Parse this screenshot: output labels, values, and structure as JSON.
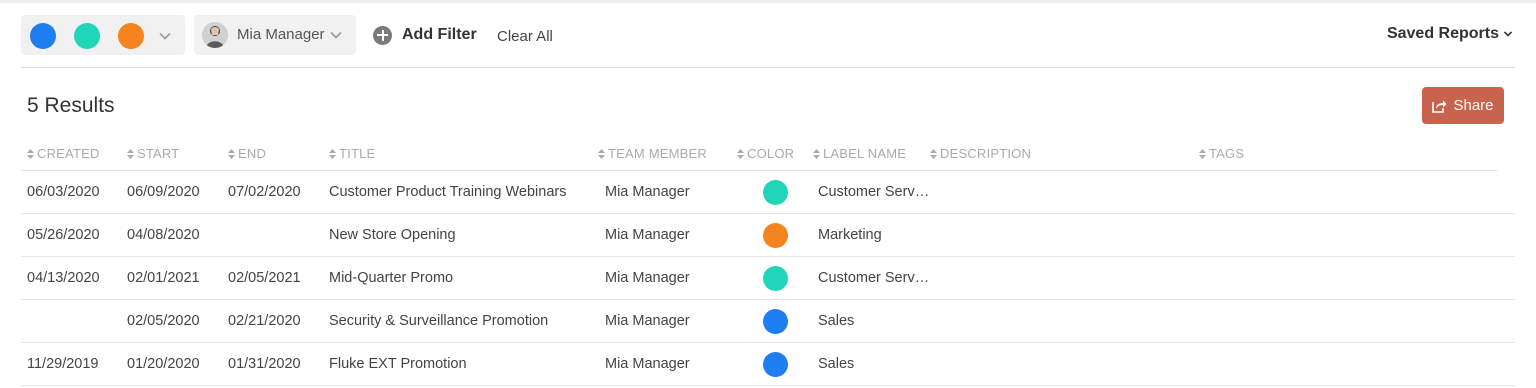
{
  "colors": {
    "blue": "#1e7ef0",
    "teal": "#1fd6b9",
    "orange": "#f5841f",
    "share_button": "#c8644d"
  },
  "filter_bar": {
    "color_filter": {
      "swatches": [
        "#1e7ef0",
        "#1fd6b9",
        "#f5841f"
      ],
      "dropdown_icon": "chevron-down-icon"
    },
    "member_filter": {
      "label": "Mia Manager",
      "avatar_icon": "avatar"
    },
    "add_filter_label": "Add Filter",
    "clear_all_label": "Clear All",
    "saved_reports_label": "Saved Reports"
  },
  "results": {
    "title": "5 Results",
    "share_label": "Share"
  },
  "table": {
    "columns": [
      "CREATED",
      "START",
      "END",
      "TITLE",
      "TEAM MEMBER",
      "COLOR",
      "LABEL NAME",
      "DESCRIPTION",
      "TAGS"
    ],
    "rows": [
      {
        "created": "06/03/2020",
        "start": "06/09/2020",
        "end": "07/02/2020",
        "title": "Customer Product Training Webinars",
        "member": "Mia Manager",
        "color": "#1fd6b9",
        "label": "Customer Serv…",
        "description": "",
        "tags": ""
      },
      {
        "created": "05/26/2020",
        "start": "04/08/2020",
        "end": "",
        "title": "New Store Opening",
        "member": "Mia Manager",
        "color": "#f5841f",
        "label": "Marketing",
        "description": "",
        "tags": ""
      },
      {
        "created": "04/13/2020",
        "start": "02/01/2021",
        "end": "02/05/2021",
        "title": "Mid-Quarter Promo",
        "member": "Mia Manager",
        "color": "#1fd6b9",
        "label": "Customer Serv…",
        "description": "",
        "tags": ""
      },
      {
        "created": "",
        "start": "02/05/2020",
        "end": "02/21/2020",
        "title": "Security & Surveillance Promotion",
        "member": "Mia Manager",
        "color": "#1e7ef0",
        "label": "Sales",
        "description": "",
        "tags": ""
      },
      {
        "created": "11/29/2019",
        "start": "01/20/2020",
        "end": "01/31/2020",
        "title": "Fluke EXT Promotion",
        "member": "Mia Manager",
        "color": "#1e7ef0",
        "label": "Sales",
        "description": "",
        "tags": ""
      }
    ]
  }
}
